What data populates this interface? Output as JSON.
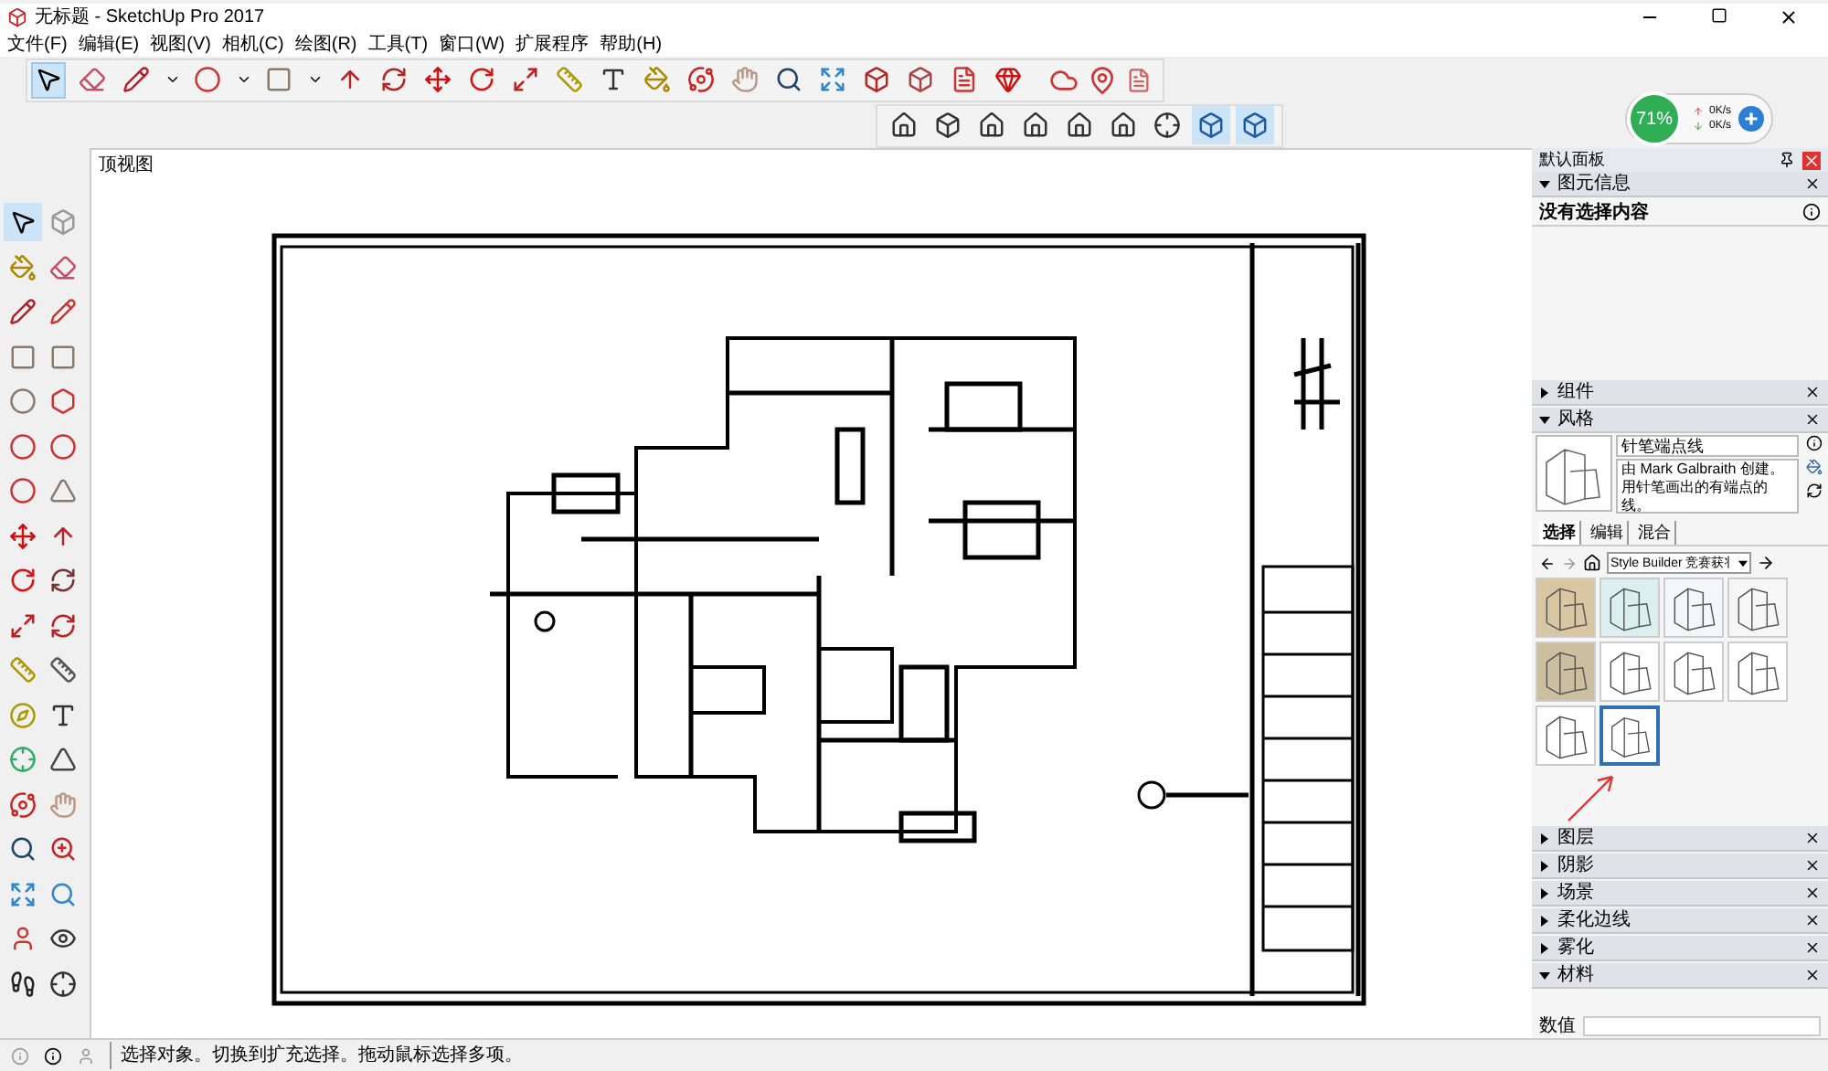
{
  "window": {
    "title": "无标题 - SketchUp Pro 2017"
  },
  "menu": [
    "文件(F)",
    "编辑(E)",
    "视图(V)",
    "相机(C)",
    "绘图(R)",
    "工具(T)",
    "窗口(W)",
    "扩展程序",
    "帮助(H)"
  ],
  "main_toolbar": [
    {
      "selected": true
    },
    {
      "selected": false
    },
    {
      "selected": false
    },
    {
      "selected": false
    },
    {
      "selected": false
    },
    {
      "selected": false
    },
    {
      "selected": false
    },
    {
      "selected": false
    },
    {
      "selected": false
    },
    {
      "selected": false
    },
    {
      "selected": false
    },
    {
      "selected": false
    },
    {
      "selected": false
    },
    {
      "selected": false
    },
    {
      "selected": false
    },
    {
      "selected": false
    },
    {
      "selected": false
    },
    {
      "selected": false
    },
    {
      "selected": false
    },
    {
      "selected": false
    },
    {
      "selected": false
    },
    {
      "selected": false
    },
    {
      "selected": false
    },
    {
      "selected": false
    }
  ],
  "views_toolbar": [
    {
      "selected": false
    },
    {
      "selected": false
    },
    {
      "selected": false
    },
    {
      "selected": false
    },
    {
      "selected": false
    },
    {
      "selected": false
    },
    {
      "selected": false
    },
    {
      "selected": true
    },
    {
      "selected": true
    }
  ],
  "left_toolbar": [
    {
      "selected": true
    },
    {
      "selected": false
    },
    {
      "selected": false
    },
    {
      "selected": false
    }
  ],
  "network_meter": {
    "percent": "71%",
    "upload": "0K/s",
    "download": "0K/s"
  },
  "viewport": {
    "label": "顶视图"
  },
  "tray": {
    "title": "默认面板",
    "entity_info": {
      "title": "图元信息",
      "expanded": true,
      "message": "没有选择内容"
    },
    "components": {
      "title": "组件",
      "expanded": false
    },
    "styles": {
      "title": "风格",
      "expanded": true,
      "name": "针笔端点线",
      "description": "由 Mark Galbraith 创建。用针笔画出的有端点的线。",
      "tabs": [
        {
          "label": "选择",
          "selected": true
        },
        {
          "label": "编辑",
          "selected": false
        },
        {
          "label": "混合",
          "selected": false
        }
      ],
      "collection": "Style Builder 竞赛获丬",
      "thumbnails": [
        {
          "color": "#d9c7a3",
          "selected": false
        },
        {
          "color": "#dcefef",
          "selected": false
        },
        {
          "color": "#f4f6fa",
          "selected": false
        },
        {
          "color": "#f6f6f6",
          "selected": false
        },
        {
          "color": "#cbbf9f",
          "selected": false
        },
        {
          "color": "#ffffff",
          "selected": false
        },
        {
          "color": "#ffffff",
          "selected": false
        },
        {
          "color": "#ffffff",
          "selected": false
        },
        {
          "color": "#ffffff",
          "selected": false
        },
        {
          "color": "#ffffff",
          "selected": true
        }
      ]
    },
    "collapsed_panels": [
      {
        "title": "图层",
        "expanded": false
      },
      {
        "title": "阴影",
        "expanded": false
      },
      {
        "title": "场景",
        "expanded": false
      },
      {
        "title": "柔化边线",
        "expanded": false
      },
      {
        "title": "雾化",
        "expanded": false
      },
      {
        "title": "材料",
        "expanded": true
      }
    ]
  },
  "status_bar": {
    "message": "选择对象。切换到扩充选择。拖动鼠标选择多项。",
    "measurement_label": "数值"
  }
}
